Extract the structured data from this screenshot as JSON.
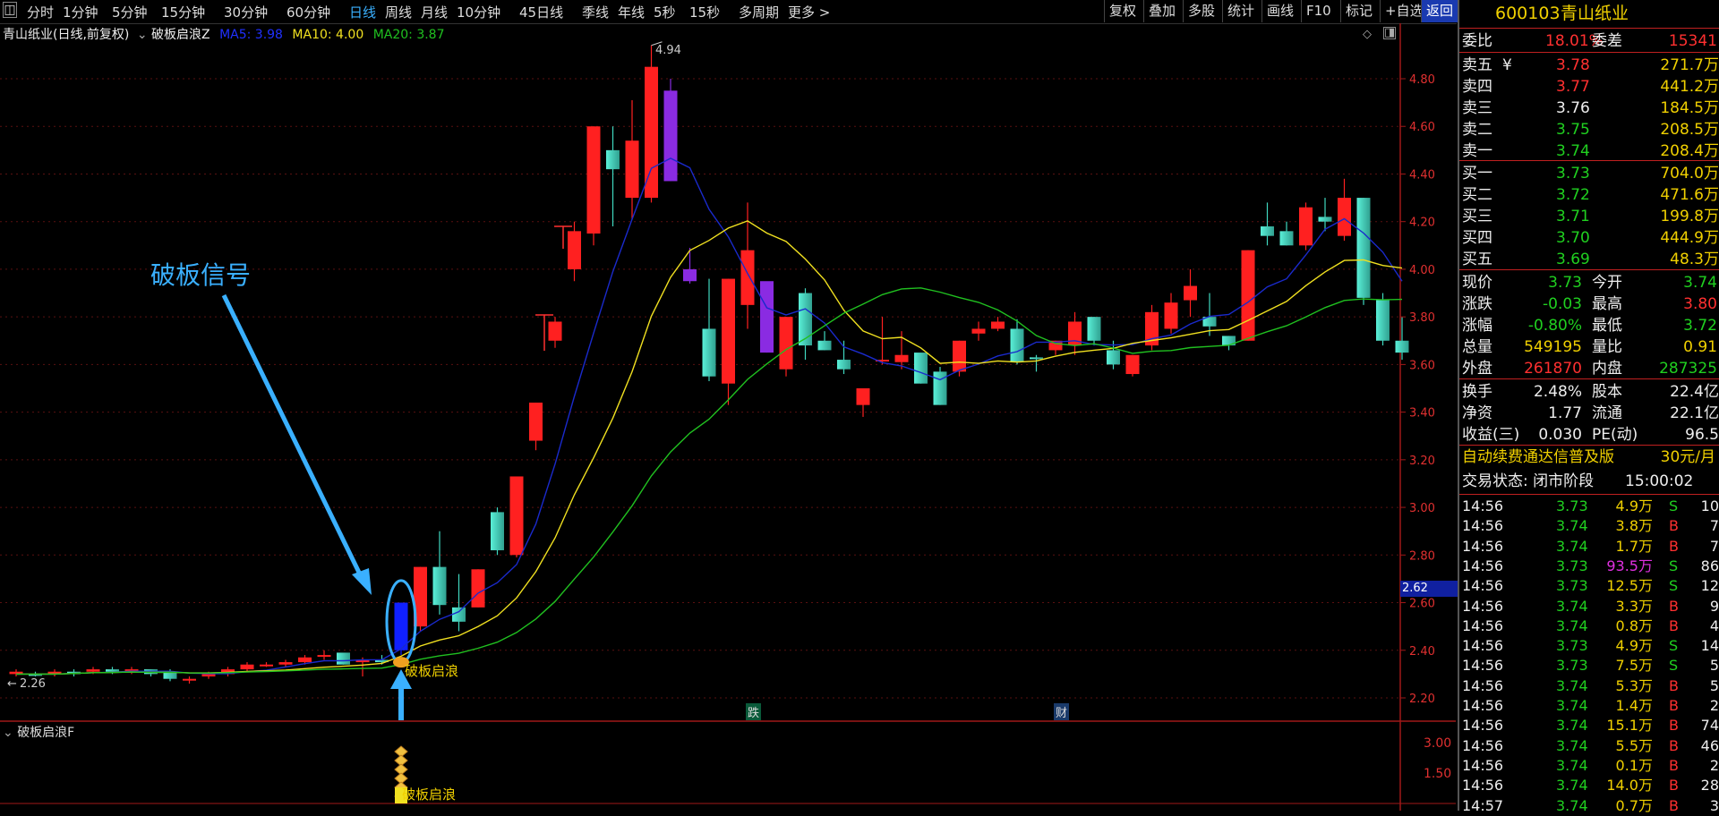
{
  "topbar": {
    "left_tabs": [
      {
        "label": "分时"
      },
      {
        "label": "1分钟"
      },
      {
        "label": "5分钟"
      },
      {
        "label": "15分钟"
      },
      {
        "label": "30分钟"
      },
      {
        "label": "60分钟"
      },
      {
        "label": "日线",
        "active": true
      },
      {
        "label": "周线"
      },
      {
        "label": "月线"
      },
      {
        "label": "10分钟"
      },
      {
        "label": "45日线"
      },
      {
        "label": "季线"
      },
      {
        "label": "年线"
      },
      {
        "label": "5秒"
      },
      {
        "label": "15秒"
      },
      {
        "label": "多周期"
      },
      {
        "label": "更多 >"
      }
    ],
    "right_tabs": [
      {
        "label": "复权"
      },
      {
        "label": "叠加"
      },
      {
        "label": "多股"
      },
      {
        "label": "统计"
      },
      {
        "label": "画线"
      },
      {
        "label": "F10"
      },
      {
        "label": "标记"
      },
      {
        "label": "+自选"
      },
      {
        "label": "返回",
        "active": true
      }
    ]
  },
  "chart_header": {
    "stock_title": "青山纸业(日线,前复权)",
    "indicator": "破板启浪Z",
    "ma5": "MA5: 3.98",
    "ma10": "MA10: 4.00",
    "ma20": "MA20: 3.87"
  },
  "annotations": {
    "signal_label": "破板信号",
    "start_label": "破板启浪",
    "start_label_lower": "破板启浪",
    "high_marker": "4.94",
    "low_marker": "2.26",
    "marker_die": "跌",
    "marker_cai": "财",
    "current_price_tag": "2.62"
  },
  "sub_indicator": {
    "name": "破板启浪F",
    "levels": [
      "3.00",
      "1.50"
    ]
  },
  "chart_data": {
    "type": "candlestick",
    "y_ticks": [
      "4.80",
      "4.60",
      "4.40",
      "4.20",
      "4.00",
      "3.80",
      "3.60",
      "3.40",
      "3.20",
      "3.00",
      "2.80",
      "2.60",
      "2.40",
      "2.20"
    ],
    "ylim": [
      2.16,
      5.0
    ],
    "candles": [
      [
        2.31,
        2.32,
        2.3,
        2.29,
        "r"
      ],
      [
        2.3,
        2.31,
        2.3,
        2.29,
        "g"
      ],
      [
        2.31,
        2.32,
        2.3,
        2.29,
        "r"
      ],
      [
        2.3,
        2.32,
        2.31,
        2.29,
        "g"
      ],
      [
        2.31,
        2.33,
        2.32,
        2.3,
        "r"
      ],
      [
        2.32,
        2.33,
        2.31,
        2.3,
        "g"
      ],
      [
        2.31,
        2.33,
        2.32,
        2.3,
        "r"
      ],
      [
        2.32,
        2.32,
        2.3,
        2.29,
        "g"
      ],
      [
        2.28,
        2.32,
        2.31,
        2.27,
        "g"
      ],
      [
        2.28,
        2.29,
        2.28,
        2.26,
        "r"
      ],
      [
        2.29,
        2.31,
        2.3,
        2.28,
        "r"
      ],
      [
        2.3,
        2.33,
        2.32,
        2.29,
        "r"
      ],
      [
        2.32,
        2.35,
        2.34,
        2.31,
        "r"
      ],
      [
        2.34,
        2.35,
        2.34,
        2.33,
        "r"
      ],
      [
        2.34,
        2.36,
        2.35,
        2.33,
        "r"
      ],
      [
        2.35,
        2.38,
        2.37,
        2.34,
        "r"
      ],
      [
        2.38,
        2.4,
        2.38,
        2.36,
        "r"
      ],
      [
        2.39,
        2.38,
        2.34,
        2.34,
        "g"
      ],
      [
        2.35,
        2.37,
        2.36,
        2.29,
        "r"
      ],
      [
        2.36,
        2.38,
        2.35,
        2.34,
        "g"
      ],
      [
        2.4,
        2.6,
        2.6,
        2.38,
        "b"
      ],
      [
        2.5,
        2.75,
        2.75,
        2.48,
        "r"
      ],
      [
        2.75,
        2.9,
        2.59,
        2.55,
        "g"
      ],
      [
        2.58,
        2.72,
        2.52,
        2.48,
        "g"
      ],
      [
        2.58,
        2.74,
        2.74,
        2.58,
        "r"
      ],
      [
        2.98,
        3.0,
        2.82,
        2.8,
        "g"
      ],
      [
        2.8,
        3.13,
        3.13,
        2.79,
        "r"
      ],
      [
        3.28,
        3.44,
        3.44,
        3.24,
        "r"
      ],
      [
        3.7,
        3.8,
        3.78,
        3.67,
        "r"
      ],
      [
        4.0,
        4.2,
        4.16,
        3.95,
        "r"
      ],
      [
        4.6,
        4.6,
        4.15,
        4.1,
        "r"
      ],
      [
        4.5,
        4.6,
        4.42,
        4.18,
        "g"
      ],
      [
        4.3,
        4.71,
        4.54,
        4.21,
        "r"
      ],
      [
        4.3,
        4.94,
        4.85,
        4.28,
        "r"
      ],
      [
        4.75,
        4.8,
        4.37,
        4.37,
        "p"
      ],
      [
        4.0,
        4.09,
        3.95,
        3.94,
        "p"
      ],
      [
        3.75,
        3.96,
        3.55,
        3.53,
        "g"
      ],
      [
        3.52,
        3.96,
        3.96,
        3.43,
        "r"
      ],
      [
        3.85,
        4.28,
        4.08,
        3.75,
        "r"
      ],
      [
        3.95,
        3.9,
        3.65,
        3.65,
        "p"
      ],
      [
        3.58,
        3.8,
        3.8,
        3.55,
        "r"
      ],
      [
        3.9,
        3.92,
        3.68,
        3.62,
        "g"
      ],
      [
        3.7,
        3.74,
        3.66,
        3.66,
        "g"
      ],
      [
        3.62,
        3.7,
        3.58,
        3.56,
        "g"
      ],
      [
        3.43,
        3.5,
        3.5,
        3.38,
        "r"
      ],
      [
        3.62,
        3.8,
        3.62,
        3.6,
        "r"
      ],
      [
        3.64,
        3.74,
        3.61,
        3.58,
        "r"
      ],
      [
        3.65,
        3.64,
        3.52,
        3.52,
        "g"
      ],
      [
        3.57,
        3.59,
        3.43,
        3.43,
        "g"
      ],
      [
        3.57,
        3.7,
        3.7,
        3.55,
        "r"
      ],
      [
        3.73,
        3.78,
        3.75,
        3.7,
        "r"
      ],
      [
        3.75,
        3.8,
        3.78,
        3.74,
        "r"
      ],
      [
        3.75,
        3.79,
        3.61,
        3.6,
        "g"
      ],
      [
        3.63,
        3.64,
        3.63,
        3.57,
        "g"
      ],
      [
        3.66,
        3.7,
        3.7,
        3.64,
        "r"
      ],
      [
        3.68,
        3.82,
        3.78,
        3.64,
        "r"
      ],
      [
        3.8,
        3.8,
        3.7,
        3.68,
        "g"
      ],
      [
        3.66,
        3.7,
        3.6,
        3.58,
        "g"
      ],
      [
        3.56,
        3.64,
        3.64,
        3.55,
        "r"
      ],
      [
        3.68,
        3.85,
        3.82,
        3.66,
        "r"
      ],
      [
        3.75,
        3.9,
        3.86,
        3.73,
        "r"
      ],
      [
        3.87,
        4.0,
        3.93,
        3.8,
        "r"
      ],
      [
        3.8,
        3.9,
        3.76,
        3.72,
        "g"
      ],
      [
        3.72,
        3.72,
        3.68,
        3.66,
        "g"
      ],
      [
        3.7,
        4.08,
        4.08,
        3.7,
        "r"
      ],
      [
        4.14,
        4.28,
        4.18,
        4.1,
        "g"
      ],
      [
        4.16,
        4.2,
        4.1,
        4.1,
        "g"
      ],
      [
        4.1,
        4.28,
        4.26,
        4.08,
        "r"
      ],
      [
        4.2,
        4.3,
        4.22,
        4.16,
        "g"
      ],
      [
        4.14,
        4.38,
        4.3,
        4.12,
        "r"
      ],
      [
        4.3,
        4.3,
        3.88,
        3.85,
        "g"
      ],
      [
        3.87,
        3.9,
        3.7,
        3.68,
        "g"
      ],
      [
        3.7,
        3.8,
        3.65,
        3.62,
        "g"
      ]
    ]
  },
  "quote_panel": {
    "code": "600103",
    "name": "青山纸业",
    "weibi_label": "委比",
    "weibi": "18.01%",
    "weicha_label": "委差",
    "weicha": "15341",
    "asks": [
      {
        "label": "卖五",
        "extra": "¥",
        "price": "3.78",
        "vol": "271.7万"
      },
      {
        "label": "卖四",
        "price": "3.77",
        "vol": "441.2万"
      },
      {
        "label": "卖三",
        "price": "3.76",
        "vol": "184.5万"
      },
      {
        "label": "卖二",
        "price": "3.75",
        "vol": "208.5万"
      },
      {
        "label": "卖一",
        "price": "3.74",
        "vol": "208.4万"
      }
    ],
    "bids": [
      {
        "label": "买一",
        "price": "3.73",
        "vol": "704.0万"
      },
      {
        "label": "买二",
        "price": "3.72",
        "vol": "471.6万"
      },
      {
        "label": "买三",
        "price": "3.71",
        "vol": "199.8万"
      },
      {
        "label": "买四",
        "price": "3.70",
        "vol": "444.9万"
      },
      {
        "label": "买五",
        "price": "3.69",
        "vol": "48.3万"
      }
    ],
    "stats": [
      {
        "l1": "现价",
        "v1": "3.73",
        "c1": "green",
        "l2": "今开",
        "v2": "3.74",
        "c2": "green"
      },
      {
        "l1": "涨跌",
        "v1": "-0.03",
        "c1": "green",
        "l2": "最高",
        "v2": "3.80",
        "c2": "red"
      },
      {
        "l1": "涨幅",
        "v1": "-0.80%",
        "c1": "green",
        "l2": "最低",
        "v2": "3.72",
        "c2": "green"
      },
      {
        "l1": "总量",
        "v1": "549195",
        "c1": "yellow",
        "l2": "量比",
        "v2": "0.91",
        "c2": "yellow"
      },
      {
        "l1": "外盘",
        "v1": "261870",
        "c1": "red",
        "l2": "内盘",
        "v2": "287325",
        "c2": "green"
      }
    ],
    "fin": [
      {
        "l1": "换手",
        "v1": "2.48%",
        "l2": "股本",
        "v2": "22.4亿"
      },
      {
        "l1": "净资",
        "v1": "1.77",
        "l2": "流通",
        "v2": "22.1亿"
      },
      {
        "l1": "收益(三)",
        "v1": "0.030",
        "l2": "PE(动)",
        "v2": "96.5"
      }
    ],
    "promo": "自动续费通达信普及版",
    "promo_price": "30元/月",
    "trade_status": "交易状态: 闭市阶段",
    "trade_time": "15:00:02",
    "ticks": [
      {
        "t": "14:56",
        "p": "3.73",
        "pc": "green",
        "v": "4.9万",
        "vc": "yellow",
        "s": "S",
        "n": "10"
      },
      {
        "t": "14:56",
        "p": "3.74",
        "pc": "green",
        "v": "3.8万",
        "vc": "yellow",
        "s": "B",
        "n": "7"
      },
      {
        "t": "14:56",
        "p": "3.74",
        "pc": "green",
        "v": "1.7万",
        "vc": "yellow",
        "s": "B",
        "n": "7"
      },
      {
        "t": "14:56",
        "p": "3.73",
        "pc": "green",
        "v": "93.5万",
        "vc": "magenta",
        "s": "S",
        "n": "86"
      },
      {
        "t": "14:56",
        "p": "3.73",
        "pc": "green",
        "v": "12.5万",
        "vc": "yellow",
        "s": "S",
        "n": "12"
      },
      {
        "t": "14:56",
        "p": "3.74",
        "pc": "green",
        "v": "3.3万",
        "vc": "yellow",
        "s": "B",
        "n": "9"
      },
      {
        "t": "14:56",
        "p": "3.74",
        "pc": "green",
        "v": "0.8万",
        "vc": "yellow",
        "s": "B",
        "n": "4"
      },
      {
        "t": "14:56",
        "p": "3.73",
        "pc": "green",
        "v": "4.9万",
        "vc": "yellow",
        "s": "S",
        "n": "14"
      },
      {
        "t": "14:56",
        "p": "3.73",
        "pc": "green",
        "v": "7.5万",
        "vc": "yellow",
        "s": "S",
        "n": "5"
      },
      {
        "t": "14:56",
        "p": "3.74",
        "pc": "green",
        "v": "5.3万",
        "vc": "yellow",
        "s": "B",
        "n": "5"
      },
      {
        "t": "14:56",
        "p": "3.74",
        "pc": "green",
        "v": "1.4万",
        "vc": "yellow",
        "s": "B",
        "n": "2"
      },
      {
        "t": "14:56",
        "p": "3.74",
        "pc": "green",
        "v": "15.1万",
        "vc": "yellow",
        "s": "B",
        "n": "74"
      },
      {
        "t": "14:56",
        "p": "3.74",
        "pc": "green",
        "v": "5.5万",
        "vc": "yellow",
        "s": "B",
        "n": "46"
      },
      {
        "t": "14:56",
        "p": "3.74",
        "pc": "green",
        "v": "0.1万",
        "vc": "yellow",
        "s": "B",
        "n": "2"
      },
      {
        "t": "14:56",
        "p": "3.74",
        "pc": "green",
        "v": "14.0万",
        "vc": "yellow",
        "s": "B",
        "n": "28"
      },
      {
        "t": "14:57",
        "p": "3.74",
        "pc": "green",
        "v": "0.7万",
        "vc": "yellow",
        "s": "B",
        "n": "3"
      }
    ]
  },
  "colors": {
    "up": "#ff2020",
    "down": "#40d8c0",
    "purple": "#8a2be2",
    "blue": "#1020ff",
    "ma5": "#1a2acc",
    "ma10": "#f0e020",
    "ma20": "#20c020",
    "accent": "#3ab0ff"
  }
}
